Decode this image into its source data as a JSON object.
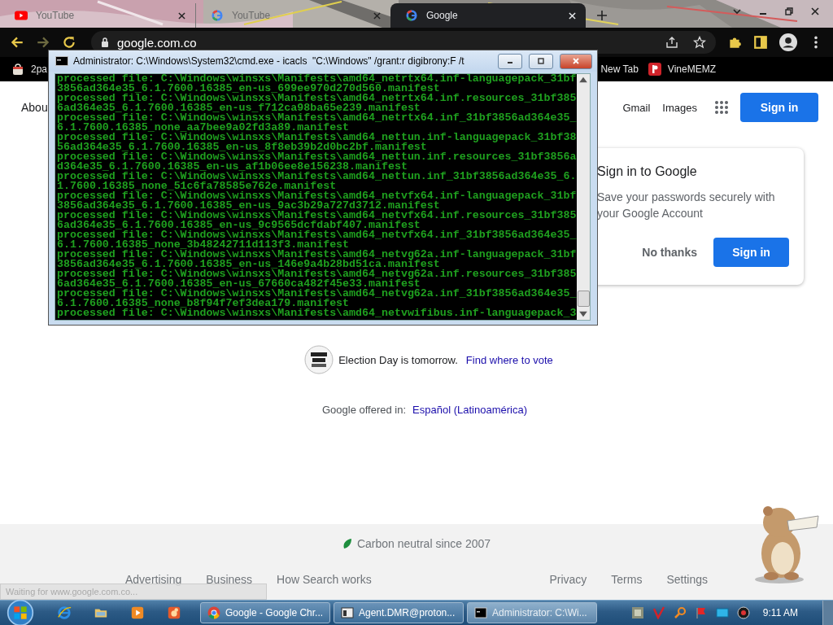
{
  "browser": {
    "tabs": [
      {
        "title": "YouTube",
        "selected": false
      },
      {
        "title": "YouTube",
        "selected": false
      },
      {
        "title": "Google",
        "selected": true
      }
    ],
    "address": "google.com.co",
    "bookmarks": [
      "2pa",
      "New Tab",
      "VineMEMZ"
    ]
  },
  "google": {
    "header_left": "Abou",
    "header_links": [
      "Gmail",
      "Images"
    ],
    "sign_in": "Sign in",
    "prompt": {
      "title": "Sign in to Google",
      "text": "Save your passwords securely with your Google Account",
      "dismiss": "No thanks",
      "confirm": "Sign in"
    },
    "election": {
      "text": "Election Day is tomorrow.",
      "link": "Find where to vote"
    },
    "offered": {
      "label": "Google offered in:",
      "language": "Español (Latinoamérica)"
    },
    "footer": {
      "carbon": "Carbon neutral since 2007",
      "left_links": [
        "Advertising",
        "Business",
        "How Search works"
      ],
      "right_links": [
        "Privacy",
        "Terms",
        "Settings"
      ]
    },
    "status": "Waiting for www.google.com.co..."
  },
  "console": {
    "title": "Administrator: C:\\Windows\\System32\\cmd.exe - icacls  \"C:\\Windows\" /grant:r digibrony:F /t",
    "lines": [
      "processed file: C:\\Windows\\winsxs\\Manifests\\amd64_netrtx64.inf-languagepack_31bf",
      "3856ad364e35_6.1.7600.16385_en-us_699ee970d270d560.manifest",
      "processed file: C:\\Windows\\winsxs\\Manifests\\amd64_netrtx64.inf.resources_31bf385",
      "6ad364e35_6.1.7600.16385_en-us_f712ca98ba65e239.manifest",
      "processed file: C:\\Windows\\winsxs\\Manifests\\amd64_netrtx64.inf_31bf3856ad364e35_",
      "6.1.7600.16385_none_aa7bee9a02fd3a89.manifest",
      "processed file: C:\\Windows\\winsxs\\Manifests\\amd64_nettun.inf-languagepack_31bf38",
      "56ad364e35_6.1.7600.16385_en-us_8f8eb39b2d0bc2bf.manifest",
      "processed file: C:\\Windows\\winsxs\\Manifests\\amd64_nettun.inf.resources_31bf3856a",
      "d364e35_6.1.7600.16385_en-us_af1b06ee8e156238.manifest",
      "processed file: C:\\Windows\\winsxs\\Manifests\\amd64_nettun.inf_31bf3856ad364e35_6.",
      "1.7600.16385_none_51c6fa78585e762e.manifest",
      "processed file: C:\\Windows\\winsxs\\Manifests\\amd64_netvfx64.inf-languagepack_31bf",
      "3856ad364e35_6.1.7600.16385_en-us_9ac3b29a727d3712.manifest",
      "processed file: C:\\Windows\\winsxs\\Manifests\\amd64_netvfx64.inf.resources_31bf385",
      "6ad364e35_6.1.7600.16385_en-us_9c9565dcfdabf407.manifest",
      "processed file: C:\\Windows\\winsxs\\Manifests\\amd64_netvfx64.inf_31bf3856ad364e35_",
      "6.1.7600.16385_none_3b48242711d113f3.manifest",
      "processed file: C:\\Windows\\winsxs\\Manifests\\amd64_netvg62a.inf-languagepack_31bf",
      "3856ad364e35_6.1.7600.16385_en-us_146e9a4b28bd51ca.manifest",
      "processed file: C:\\Windows\\winsxs\\Manifests\\amd64_netvg62a.inf.resources_31bf385",
      "6ad364e35_6.1.7600.16385_en-us_67660ca482f45e33.manifest",
      "processed file: C:\\Windows\\winsxs\\Manifests\\amd64_netvg62a.inf_31bf3856ad364e35_",
      "6.1.7600.16385_none_b8f94f7ef3dea179.manifest",
      "processed file: C:\\Windows\\winsxs\\Manifests\\amd64_netvwifibus.inf-languagepack_3"
    ]
  },
  "taskbar": {
    "tasks": [
      {
        "label": "Google - Google Chr...",
        "selected": false
      },
      {
        "label": "Agent.DMR@proton...",
        "selected": false
      },
      {
        "label": "Administrator: C:\\Wi...",
        "selected": true
      }
    ],
    "clock": "9:11 AM"
  }
}
